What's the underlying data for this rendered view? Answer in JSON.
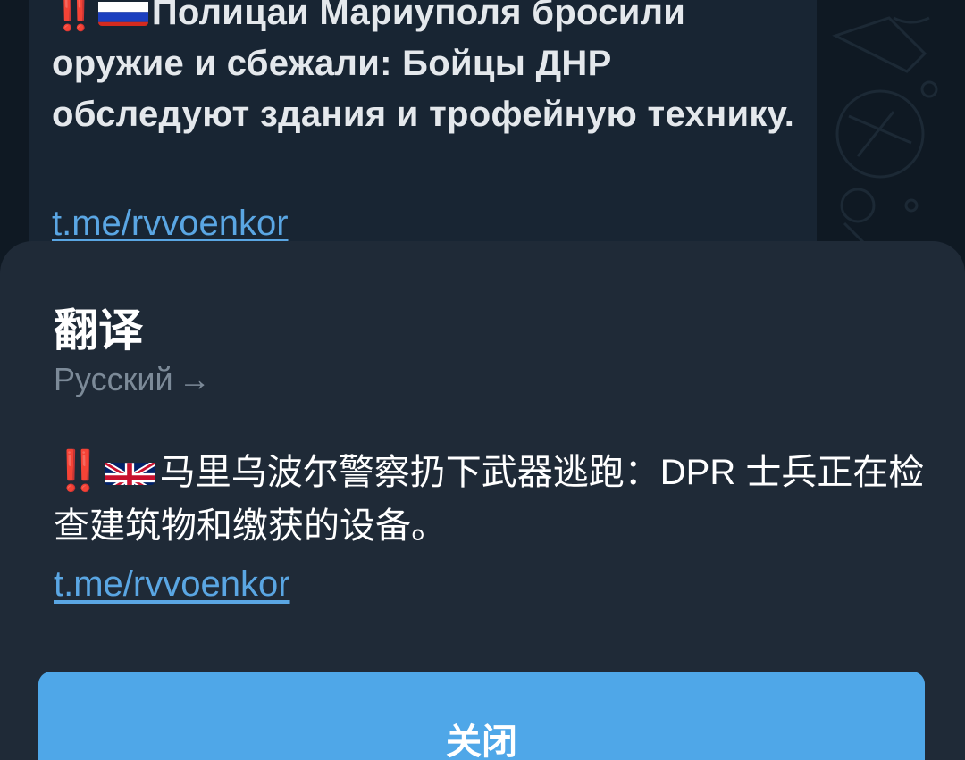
{
  "message": {
    "alert_marks": "‼️",
    "flag_icon": "russia-flag-icon",
    "text": "Полицаи Мариуполя бросили оружие и сбежали: Бойцы ДНР обследуют здания и трофейную технику.",
    "link": "t.me/rvvoenkor"
  },
  "translation_sheet": {
    "title": "翻译",
    "source_language": "Русский",
    "arrow": "→",
    "alert_marks": "‼️",
    "flag_icon": "uk-flag-icon",
    "translated_text": "马里乌波尔警察扔下武器逃跑：DPR 士兵正在检查建筑物和缴获的设备。",
    "link": "t.me/rvvoenkor",
    "close_label": "关闭"
  },
  "colors": {
    "background": "#0e1621",
    "bubble": "#182533",
    "sheet": "#1f2a37",
    "link": "#5aa6e3",
    "button": "#4fa7e8",
    "alert": "#e8262f"
  }
}
